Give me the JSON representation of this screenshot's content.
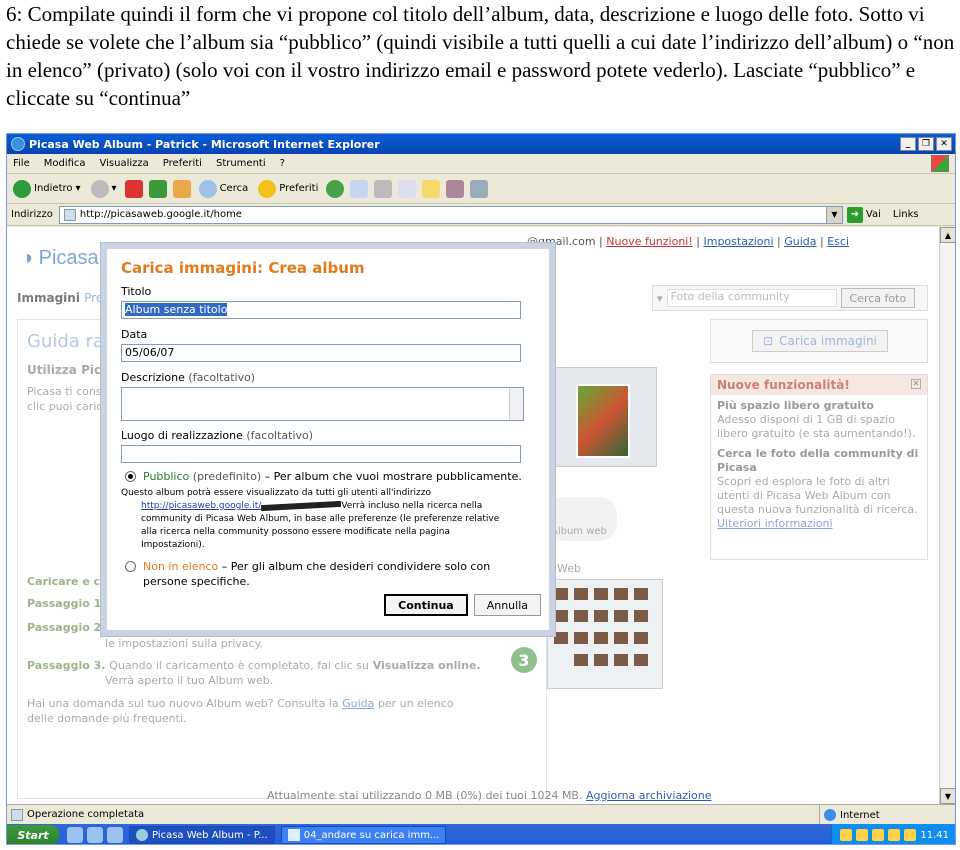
{
  "instruction": "6: Compilate quindi il form che vi propone col titolo dell’album, data, descrizione e luogo delle foto. Sotto vi chiede se volete che l’album sia “pubblico” (quindi visibile a tutti quelli a cui date l’indirizzo dell’album) o “non in elenco” (privato) (solo voi con il vostro indirizzo email e password potete vederlo). Lasciate “pubblico” e cliccate su “continua”",
  "window": {
    "title": "Picasa Web Album - Patrick - Microsoft Internet Explorer"
  },
  "menu": [
    "File",
    "Modifica",
    "Visualizza",
    "Preferiti",
    "Strumenti",
    "?"
  ],
  "toolbar": {
    "back": "Indietro",
    "search": "Cerca",
    "favorites": "Preferiti"
  },
  "address": {
    "label": "Indirizzo",
    "url": "http://picasaweb.google.it/home",
    "go": "Vai",
    "links": "Links"
  },
  "picasa": {
    "logo": "Picasa",
    "email": "@gmail.com",
    "links": {
      "new_features": "Nuove funzioni!",
      "settings": "Impostazioni",
      "guide": "Guida",
      "exit": "Esci"
    },
    "nav": {
      "images": "Immagini",
      "pre": "Pre"
    },
    "search_placeholder": "Foto della community",
    "search_btn": "Cerca foto",
    "upload_btn": "Carica immagini",
    "guide_title": "Guida ra",
    "util_title": "Utilizza Pic",
    "text1": "Picasa ti cons",
    "text2": "clic puoi caric",
    "upload_heading": "Caricare e c",
    "step1": "Passaggio 1.",
    "step2": "Passaggio 2.",
    "step2_text": "le impostazioni sulla privacy.",
    "step3": "Passaggio 3.",
    "step3_text_a": "Quando il caricamento è completato, fai clic su",
    "step3_bold": "Visualizza online",
    "step3_text_b": "Verrà aperto il tuo Album web.",
    "faq_a": "Hai una domanda sul tuo nuovo Album web? Consulta la",
    "faq_link": "Guida",
    "faq_b": "per un elenco",
    "faq_c": "delle domande più frequenti.",
    "footer": "Attualmente stai utilizzando 0 MB (0%) dei tuoi 1024 MB.",
    "footer_link": "Aggiorna archiviazione",
    "album_web": "Album web",
    "web": "Web",
    "step_num": "3",
    "news": {
      "title": "Nuove funzionalità!",
      "h1": "Più spazio libero gratuito",
      "p1": "Adesso disponi di 1 GB di spazio libero gratuito (e sta aumentando!).",
      "h2": "Cerca le foto della community di Picasa",
      "p2": "Scopri ed esplora le foto di altri utenti di Picasa Web Album con questa nuova funzionalità di ricerca.",
      "more": "Ulteriori informazioni"
    }
  },
  "dialog": {
    "title": "Carica immagini: Crea album",
    "title_label": "Titolo",
    "title_value": "Album senza titolo",
    "date_label": "Data",
    "date_value": "05/06/07",
    "desc_label": "Descrizione",
    "optional": "(facoltativo)",
    "place_label": "Luogo di realizzazione",
    "public_label": "Pubblico",
    "public_default": "(predefinito)",
    "public_desc": "– Per album che vuoi mostrare pubblicamente.",
    "info1": "Questo album potrà essere visualizzato da tutti gli utenti all'indirizzo",
    "info_link": "http://picasaweb.google.it/",
    "info2": "Verrà incluso nella ricerca nella",
    "info3": "community di Picasa Web Album, in base alle preferenze (le preferenze relative",
    "info4": "alla ricerca nella community possono essere modificate nella pagina",
    "info5": "Impostazioni).",
    "unlisted_label": "Non in elenco",
    "unlisted_desc": "– Per gli album che desideri condividere solo con persone specifiche.",
    "continue": "Continua",
    "cancel": "Annulla"
  },
  "status": {
    "text": "Operazione completata",
    "zone": "Internet"
  },
  "taskbar": {
    "start": "Start",
    "task1": "Picasa Web Album - P...",
    "task2": "04_andare su carica imm...",
    "clock": "11.41"
  },
  "colors": {
    "accent": "#e07b1b",
    "link": "#2a5db0",
    "xp_blue": "#245edc"
  }
}
